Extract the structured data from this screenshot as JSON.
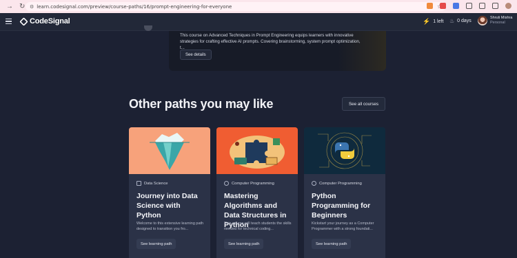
{
  "browser": {
    "url": "learn.codesignal.com/preview/course-paths/16/prompt-engineering-for-everyone"
  },
  "header": {
    "brand": "CodeSignal",
    "lives": "1 left",
    "streak": "0 days",
    "user_name": "Shruti Mishra",
    "user_plan": "Personal"
  },
  "course": {
    "description": "This course on Advanced Techniques in Prompt Engineering equips learners with innovative strategies for crafting effective AI prompts. Covering brainstorming, system prompt optimization, t...",
    "details_button": "See details"
  },
  "section": {
    "title": "Other paths you may like",
    "see_all": "See all courses"
  },
  "paths": [
    {
      "category": "Data Science",
      "title": "Journey into Data Science with Python",
      "description": "Welcome to this extensive learning path designed to transition you fro...",
      "button": "See learning path",
      "image_bg": "#f7a27b"
    },
    {
      "category": "Computer Programming",
      "title": "Mastering Algorithms and Data Structures in Python",
      "description": "This course will teach students the skills needed for technical coding...",
      "button": "See learning path",
      "image_bg": "#f05d32"
    },
    {
      "category": "Computer Programming",
      "title": "Python Programming for Beginners",
      "description": "Kickstart your journey as a Computer Programmer with a strong foundati...",
      "button": "See learning path",
      "image_bg": "#0f2a3d"
    }
  ]
}
